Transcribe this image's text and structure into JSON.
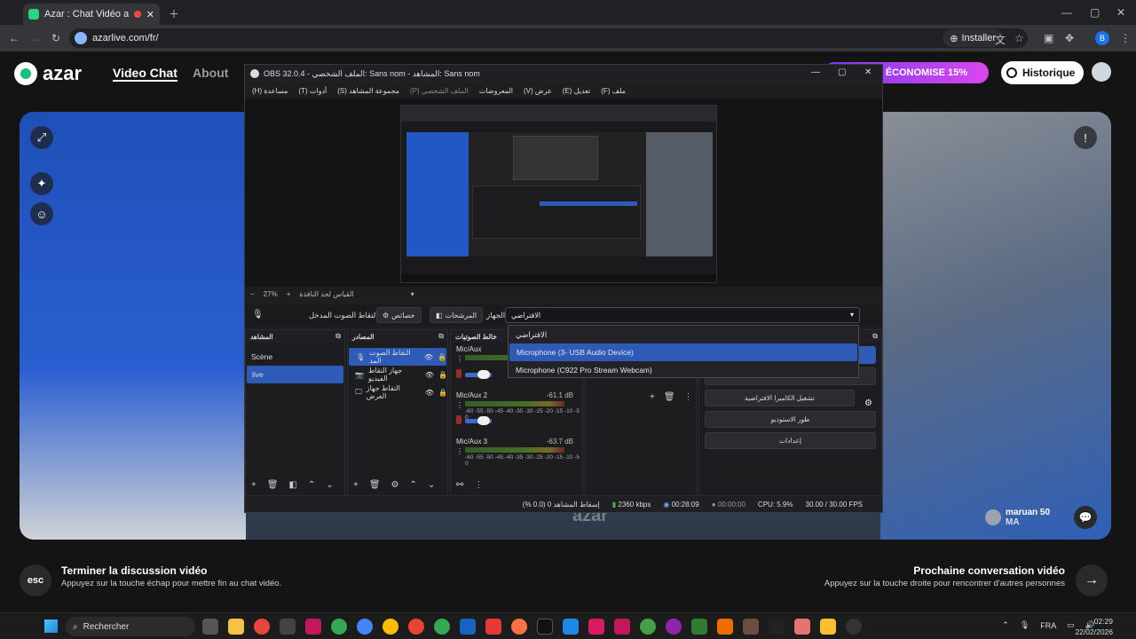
{
  "browser": {
    "tab_title": "Azar : Chat Vidéo avec de",
    "url": "azarlive.com/fr/",
    "install_label": "Installer",
    "profile_initial": "B"
  },
  "site": {
    "logo_text": "azar",
    "nav": [
      "Video Chat",
      "About"
    ],
    "promo": "ÉCONOMISE 15%",
    "history_label": "Historique",
    "watermark": "azar",
    "remote_user_name": "maruan 50",
    "remote_user_country": "MA",
    "esc_label": "esc",
    "end_title": "Terminer la discussion vidéo",
    "end_sub": "Appuyez sur la touche échap pour mettre fin au chat vidéo.",
    "next_title": "Prochaine conversation vidéo",
    "next_sub": "Appuyez sur la touche droite pour rencontrer d'autres personnes"
  },
  "obs": {
    "title": "OBS 32.0.4 - الملف الشخصي: Sans nom - المشاهد: Sans nom",
    "menu": [
      "ملف (F)",
      "تعديل (E)",
      "عرض (V)",
      "المعروضات",
      "الملف الشخصي (P)",
      "مجموعة المشاهد (S)",
      "أدوات (T)",
      "مساعدة (H)"
    ],
    "zoom": "27%",
    "zoom_label": "القياس لحد النافذة",
    "audio_bar": {
      "source_label": "التقاط الصوت المدخل",
      "properties_label": "خصائص",
      "filters_label": "المرشحات",
      "device_label": "الجهاز",
      "device_value": "الافتراضي"
    },
    "device_options": [
      "الافتراضي",
      "Microphone (3- USB Audio Device)",
      "Microphone (C922 Pro Stream Webcam)"
    ],
    "scenes_header": "المشاهد",
    "scenes": [
      "Scène",
      "live"
    ],
    "sources_header": "المصادر",
    "sources": [
      "التقاط الصوت المد",
      "جهاز التقاط الفيديو",
      "التقاط جهاز العرض"
    ],
    "mixer_header": "خالط الصوتيات",
    "mixer": [
      {
        "name": "Mic/Aux",
        "db": ""
      },
      {
        "name": "Mic/Aux 2",
        "db": "-61.1 dB"
      },
      {
        "name": "Mic/Aux 3",
        "db": "-63.7 dB"
      }
    ],
    "meter_scale": "-60 -55 -50 -45 -40 -35 -30 -25 -20 -15 -10 -5 0",
    "controls": [
      "تشغيل الكاميرا الافتراضية",
      "طور الاستوديو",
      "إعدادات"
    ],
    "status": {
      "dropped": "إسقاط المشاهد 0 (0.0 %)",
      "bitrate": "2360 kbps",
      "rec_time": "00:28:09",
      "stream_time": "00:00:00",
      "cpu": "CPU: 5.9%",
      "fps": "30.00 / 30.00 FPS"
    }
  },
  "taskbar": {
    "search_placeholder": "Rechercher",
    "lang": "FRA",
    "time": "02:29",
    "date": "22/02/2026"
  }
}
